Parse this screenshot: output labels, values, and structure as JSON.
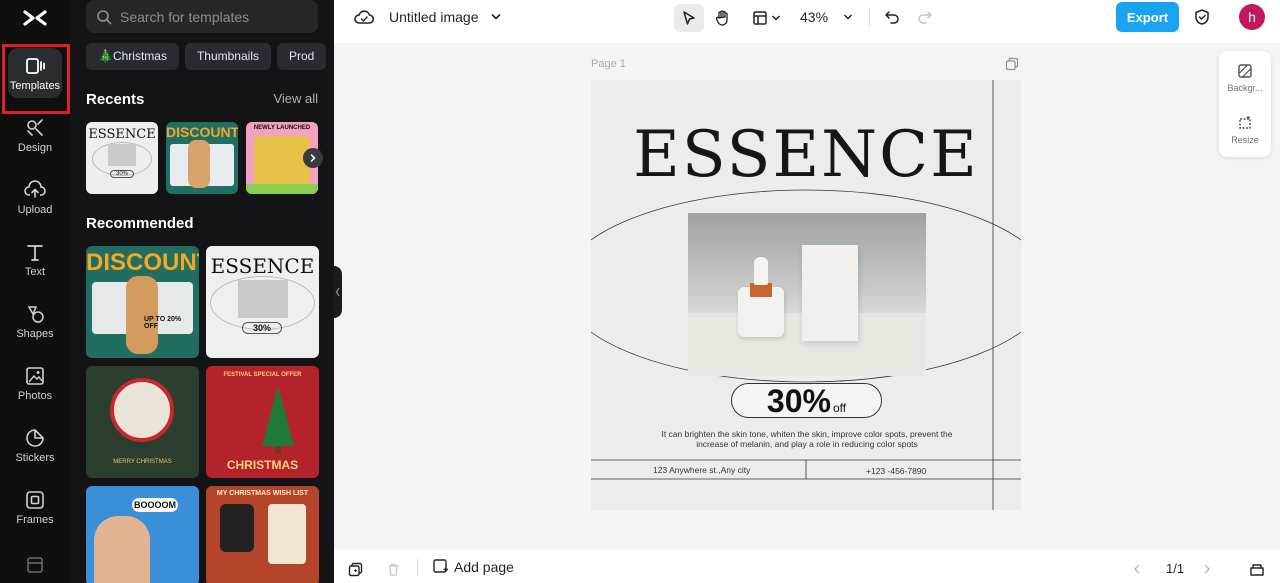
{
  "rail": {
    "items": [
      {
        "label": "Templates"
      },
      {
        "label": "Design"
      },
      {
        "label": "Upload"
      },
      {
        "label": "Text"
      },
      {
        "label": "Shapes"
      },
      {
        "label": "Photos"
      },
      {
        "label": "Stickers"
      },
      {
        "label": "Frames"
      }
    ]
  },
  "panel": {
    "search_placeholder": "Search for templates",
    "chips": [
      "🎄Christmas",
      "Thumbnails",
      "Prod"
    ],
    "recents_title": "Recents",
    "view_all": "View all",
    "recommended_title": "Recommended",
    "thumbs": {
      "essence": "ESSENCE",
      "essence_offer": "30%",
      "discount": "DISCOUNT",
      "newly_launched": "NEWLY LAUNCHED",
      "up_to": "UP TO 20% OFF",
      "merry": "MERRY CHRISTMAS",
      "festival": "FESTIVAL SPECIAL OFFER",
      "christmas": "CHRISTMAS",
      "boooom": "BOOOOM",
      "wish_list": "MY CHRISTMAS WISH LIST"
    }
  },
  "topbar": {
    "doc_title": "Untitled image",
    "zoom": "43%",
    "export_label": "Export",
    "avatar_initial": "h"
  },
  "canvas": {
    "page_label": "Page 1",
    "design": {
      "brand": "ESSENCE",
      "offer_pct": "30%",
      "offer_off": "off",
      "description": "It can brighten the skin tone, whiten the skin, improve color spots, prevent the increase of melanin, and play a role in reducing color spots",
      "address": "123 Anywhere st.,Any city",
      "phone": "+123 -456-7890"
    }
  },
  "side_panel": {
    "background_label": "Backgr...",
    "resize_label": "Resize"
  },
  "bottombar": {
    "add_page_label": "Add page",
    "page_count": "1/1"
  },
  "colors": {
    "accent": "#1aa3ef",
    "rail_bg": "#0f0f10",
    "panel_bg": "#141416",
    "highlight": "#e11d2a",
    "avatar": "#c0185a"
  }
}
